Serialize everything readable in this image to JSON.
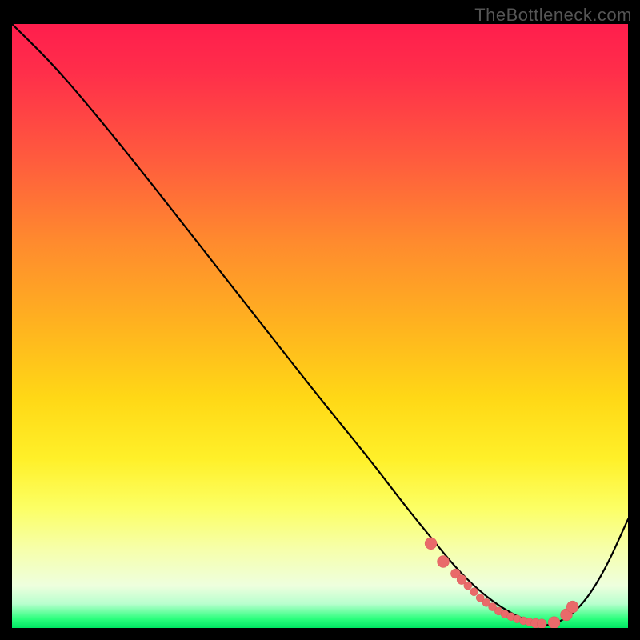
{
  "watermark": "TheBottleneck.com",
  "colors": {
    "top": "#ff1e4d",
    "mid": "#ffd816",
    "bottom": "#00e663",
    "curve": "#000000",
    "dots": "#e96a6a"
  },
  "chart_data": {
    "type": "line",
    "title": "",
    "xlabel": "",
    "ylabel": "",
    "xlim": [
      0,
      100
    ],
    "ylim": [
      0,
      100
    ],
    "series": [
      {
        "name": "bottleneck-curve",
        "x": [
          0,
          6,
          12,
          20,
          30,
          40,
          50,
          58,
          64,
          68,
          72,
          76,
          80,
          84,
          86,
          88,
          92,
          96,
          100
        ],
        "y": [
          100,
          94,
          87,
          77,
          64,
          51,
          38,
          28,
          20,
          15,
          10,
          6,
          3,
          1,
          0.5,
          0.5,
          3,
          9,
          18
        ]
      }
    ],
    "highlight_points": {
      "name": "optimal-zone-dots",
      "x": [
        68,
        70,
        72,
        73,
        74,
        75,
        76,
        77,
        78,
        79,
        80,
        81,
        82,
        83,
        84,
        85,
        86,
        88,
        90,
        91
      ],
      "y": [
        14,
        11,
        9,
        8,
        7,
        6,
        5,
        4.2,
        3.5,
        2.8,
        2.3,
        1.9,
        1.5,
        1.2,
        1.0,
        0.8,
        0.7,
        0.9,
        2.2,
        3.5
      ]
    }
  }
}
